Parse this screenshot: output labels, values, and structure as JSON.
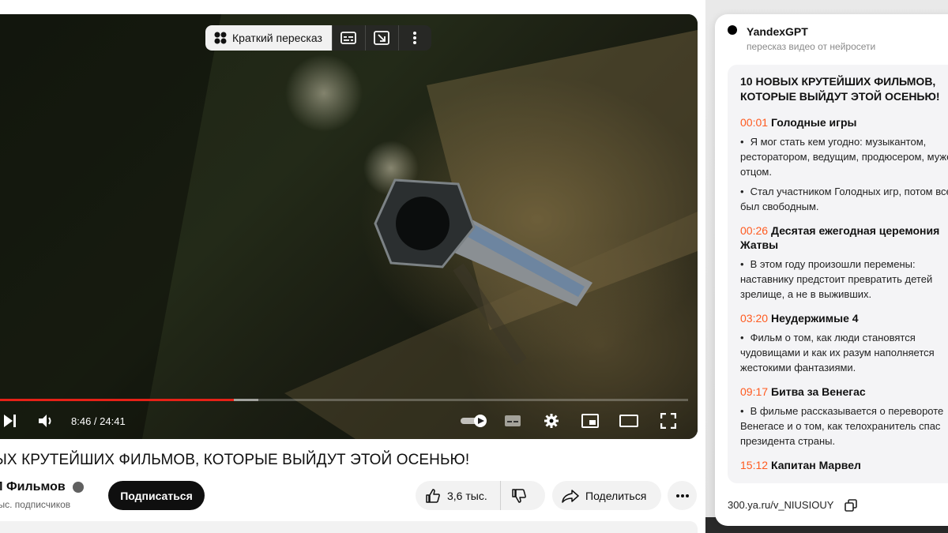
{
  "player": {
    "pill_label": "Краткий пересказ",
    "time": "8:46 / 24:41",
    "progress": 0.355,
    "buffered": 0.39
  },
  "video": {
    "title": "ЫХ КРУТЕЙШИХ ФИЛЬМОВ, КОТОРЫЕ ВЫЙДУТ ЭТОЙ ОСЕНЬЮ!",
    "channel": "П Фильмов",
    "subscribers": "тыс. подписчиков",
    "subscribe_label": "Подписаться",
    "likes": "3,6 тыс.",
    "share_label": "Поделиться"
  },
  "panel": {
    "brand": "YandexGPT",
    "subtitle": "пересказ видео от нейросети",
    "summary_title": "10 НОВЫХ КРУТЕЙШИХ ФИЛЬМОВ, КОТОРЫЕ ВЫЙДУТ ЭТОЙ ОСЕНЬЮ!",
    "sections": [
      {
        "time": "00:01",
        "heading": "Голодные игры",
        "bullets": [
          "Я мог стать кем угодно: музыкантом, ресторатором, ведущим, продюсером, мужем, отцом.",
          "Стал участником Голодных игр, потом всегда был свободным."
        ]
      },
      {
        "time": "00:26",
        "heading": "Десятая ежегодная церемония Жатвы",
        "bullets": [
          "В этом году произошли перемены: наставнику предстоит превратить детей зрелище, а не в выживших."
        ]
      },
      {
        "time": "03:20",
        "heading": "Неудержимые 4",
        "bullets": [
          "Фильм о том, как люди становятся чудовищами и как их разум наполняется жестокими фантазиями."
        ]
      },
      {
        "time": "09:17",
        "heading": "Битва за Венегас",
        "bullets": [
          "В фильме рассказывается о перевороте Венегасе и о том, как телохранитель спас президента страны."
        ]
      },
      {
        "time": "15:12",
        "heading": "Капитан Марвел",
        "bullets": []
      }
    ],
    "link": "300.ya.ru/v_NIUSIOUY"
  },
  "colors": {
    "progress_red": "#e62117",
    "timestamp_orange": "#ff5a1f",
    "subscribe_bg": "#0f0f0f"
  }
}
